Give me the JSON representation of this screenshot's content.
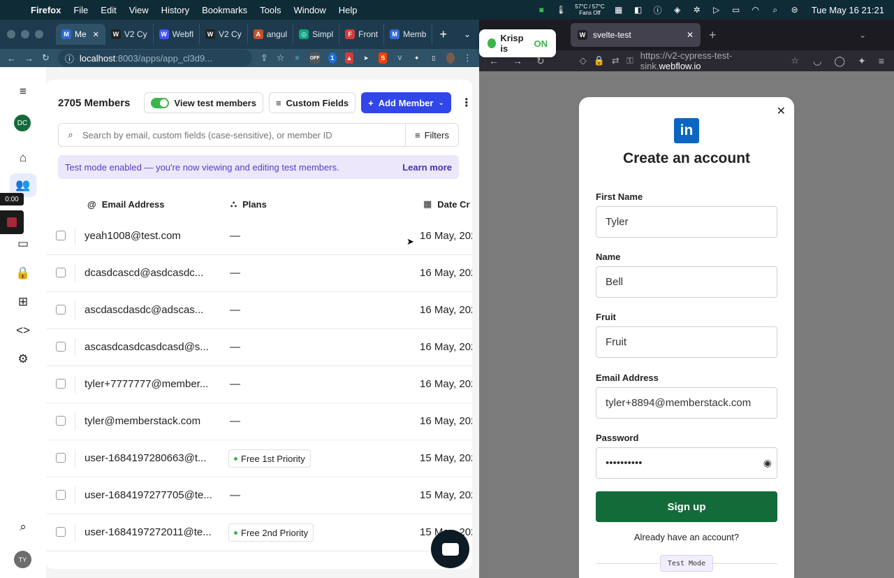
{
  "menubar": {
    "app_name": "Firefox",
    "menus": [
      "File",
      "Edit",
      "View",
      "History",
      "Bookmarks",
      "Tools",
      "Window",
      "Help"
    ],
    "temperature": "57°C / 57°C",
    "fans": "Fans Off",
    "clock": "Tue May 16  21:21"
  },
  "chrome": {
    "tabs": [
      {
        "label": "Me",
        "icon_color": "#2e6bd8"
      },
      {
        "label": "V2 Cy",
        "icon_color": "#222222"
      },
      {
        "label": "Webfl",
        "icon_color": "#4353ff"
      },
      {
        "label": "V2 Cy",
        "icon_color": "#222222"
      },
      {
        "label": "angul",
        "icon_color": "#c6502b"
      },
      {
        "label": "Simpl",
        "icon_color": "#10a37f"
      },
      {
        "label": "Front",
        "icon_color": "#d73a3a"
      },
      {
        "label": "Memb",
        "icon_color": "#2e6bd8"
      }
    ],
    "url_host": "localhost",
    "url_path": ":8003/apps/app_cl3d9..."
  },
  "app": {
    "member_count": "2705 Members",
    "view_test_members": "View test members",
    "custom_fields": "Custom Fields",
    "add_member": "Add Member",
    "search_placeholder": "Search by email, custom fields (case-sensitive), or member ID",
    "filters": "Filters",
    "banner_text": "Test mode enabled — you're now viewing and editing test members.",
    "learn_more": "Learn more",
    "columns": {
      "email": "Email Address",
      "plans": "Plans",
      "date": "Date Cr"
    },
    "rail": {
      "avatar": "DC",
      "user": "TY",
      "rec_time": "0:00"
    },
    "rows": [
      {
        "email": "yeah1008@test.com",
        "plan": "—",
        "date": "16 May, 202"
      },
      {
        "email": "dcasdcascd@asdcasdc...",
        "plan": "—",
        "date": "16 May, 202"
      },
      {
        "email": "ascdascdasdc@adscas...",
        "plan": "—",
        "date": "16 May, 202"
      },
      {
        "email": "ascasdcasdcasdcasd@s...",
        "plan": "—",
        "date": "16 May, 202"
      },
      {
        "email": "tyler+7777777@member...",
        "plan": "—",
        "date": "16 May, 202"
      },
      {
        "email": "tyler@memberstack.com",
        "plan": "—",
        "date": "16 May, 202"
      },
      {
        "email": "user-1684197280663@t...",
        "plan": "Free 1st Priority",
        "date": "15 May, 202"
      },
      {
        "email": "user-1684197277705@te...",
        "plan": "—",
        "date": "15 May, 202"
      },
      {
        "email": "user-1684197272011@te...",
        "plan": "Free 2nd Priority",
        "date": "15 May, 202"
      }
    ]
  },
  "firefox": {
    "tab_title": "svelte-test",
    "url_prefix": "https://v2-cypress-test-sink.",
    "url_domain": "webflow.io",
    "krisp_label": "Krisp is",
    "krisp_state": "ON"
  },
  "signup": {
    "title": "Create an account",
    "logo_text": "in",
    "fields": [
      {
        "label": "First Name",
        "value": "Tyler"
      },
      {
        "label": "Name",
        "value": "Bell"
      },
      {
        "label": "Fruit",
        "value": "Fruit"
      },
      {
        "label": "Email Address",
        "value": "tyler+8894@memberstack.com"
      },
      {
        "label": "Password",
        "value": "••••••••••"
      }
    ],
    "button": "Sign up",
    "already": "Already have an account?",
    "test_mode": "Test Mode"
  }
}
